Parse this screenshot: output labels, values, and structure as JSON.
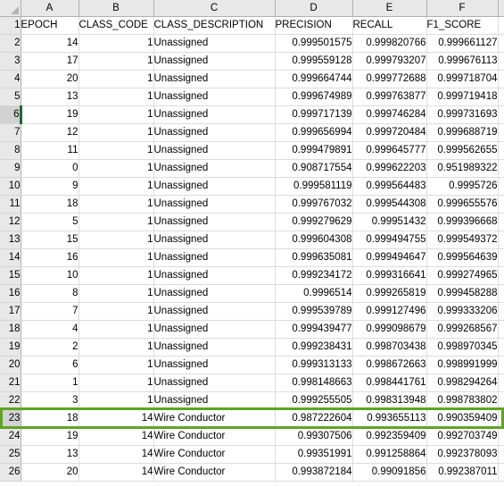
{
  "app": {
    "type": "spreadsheet",
    "select_all_corner_icon": "select-all-triangle-icon"
  },
  "colors": {
    "selection_green": "#5fa425",
    "active_marker_green": "#1d6b33",
    "header_gray": "#e8e8e8",
    "gridline": "#dcdcdc",
    "header_border": "#b0b0b0"
  },
  "column_headers": [
    "A",
    "B",
    "C",
    "D",
    "E",
    "F"
  ],
  "header_row_number": "1",
  "table": {
    "columns": [
      "EPOCH",
      "CLASS_CODE",
      "CLASS_DESCRIPTION",
      "PRECISION",
      "RECALL",
      "F1_SCORE"
    ],
    "rows": [
      {
        "n": "2",
        "EPOCH": "14",
        "CLASS_CODE": "1",
        "CLASS_DESCRIPTION": "Unassigned",
        "PRECISION": "0.999501575",
        "RECALL": "0.999820766",
        "F1_SCORE": "0.999661127"
      },
      {
        "n": "3",
        "EPOCH": "17",
        "CLASS_CODE": "1",
        "CLASS_DESCRIPTION": "Unassigned",
        "PRECISION": "0.999559128",
        "RECALL": "0.999793207",
        "F1_SCORE": "0.999676113"
      },
      {
        "n": "4",
        "EPOCH": "20",
        "CLASS_CODE": "1",
        "CLASS_DESCRIPTION": "Unassigned",
        "PRECISION": "0.999664744",
        "RECALL": "0.999772688",
        "F1_SCORE": "0.999718704"
      },
      {
        "n": "5",
        "EPOCH": "13",
        "CLASS_CODE": "1",
        "CLASS_DESCRIPTION": "Unassigned",
        "PRECISION": "0.999674989",
        "RECALL": "0.999763877",
        "F1_SCORE": "0.999719418"
      },
      {
        "n": "6",
        "EPOCH": "19",
        "CLASS_CODE": "1",
        "CLASS_DESCRIPTION": "Unassigned",
        "PRECISION": "0.999717139",
        "RECALL": "0.999746284",
        "F1_SCORE": "0.999731693"
      },
      {
        "n": "7",
        "EPOCH": "12",
        "CLASS_CODE": "1",
        "CLASS_DESCRIPTION": "Unassigned",
        "PRECISION": "0.999656994",
        "RECALL": "0.999720484",
        "F1_SCORE": "0.999688719"
      },
      {
        "n": "8",
        "EPOCH": "11",
        "CLASS_CODE": "1",
        "CLASS_DESCRIPTION": "Unassigned",
        "PRECISION": "0.999479891",
        "RECALL": "0.999645777",
        "F1_SCORE": "0.999562655"
      },
      {
        "n": "9",
        "EPOCH": "0",
        "CLASS_CODE": "1",
        "CLASS_DESCRIPTION": "Unassigned",
        "PRECISION": "0.908717554",
        "RECALL": "0.999622203",
        "F1_SCORE": "0.951989322"
      },
      {
        "n": "10",
        "EPOCH": "9",
        "CLASS_CODE": "1",
        "CLASS_DESCRIPTION": "Unassigned",
        "PRECISION": "0.999581119",
        "RECALL": "0.999564483",
        "F1_SCORE": "0.9995726"
      },
      {
        "n": "11",
        "EPOCH": "18",
        "CLASS_CODE": "1",
        "CLASS_DESCRIPTION": "Unassigned",
        "PRECISION": "0.999767032",
        "RECALL": "0.999544308",
        "F1_SCORE": "0.999655576"
      },
      {
        "n": "12",
        "EPOCH": "5",
        "CLASS_CODE": "1",
        "CLASS_DESCRIPTION": "Unassigned",
        "PRECISION": "0.999279629",
        "RECALL": "0.99951432",
        "F1_SCORE": "0.999396668"
      },
      {
        "n": "13",
        "EPOCH": "15",
        "CLASS_CODE": "1",
        "CLASS_DESCRIPTION": "Unassigned",
        "PRECISION": "0.999604308",
        "RECALL": "0.999494755",
        "F1_SCORE": "0.999549372"
      },
      {
        "n": "14",
        "EPOCH": "16",
        "CLASS_CODE": "1",
        "CLASS_DESCRIPTION": "Unassigned",
        "PRECISION": "0.999635081",
        "RECALL": "0.999494647",
        "F1_SCORE": "0.999564639"
      },
      {
        "n": "15",
        "EPOCH": "10",
        "CLASS_CODE": "1",
        "CLASS_DESCRIPTION": "Unassigned",
        "PRECISION": "0.999234172",
        "RECALL": "0.999316641",
        "F1_SCORE": "0.999274965"
      },
      {
        "n": "16",
        "EPOCH": "8",
        "CLASS_CODE": "1",
        "CLASS_DESCRIPTION": "Unassigned",
        "PRECISION": "0.9996514",
        "RECALL": "0.999265819",
        "F1_SCORE": "0.999458288"
      },
      {
        "n": "17",
        "EPOCH": "7",
        "CLASS_CODE": "1",
        "CLASS_DESCRIPTION": "Unassigned",
        "PRECISION": "0.999539789",
        "RECALL": "0.999127496",
        "F1_SCORE": "0.999333206"
      },
      {
        "n": "18",
        "EPOCH": "4",
        "CLASS_CODE": "1",
        "CLASS_DESCRIPTION": "Unassigned",
        "PRECISION": "0.999439477",
        "RECALL": "0.999098679",
        "F1_SCORE": "0.999268567"
      },
      {
        "n": "19",
        "EPOCH": "2",
        "CLASS_CODE": "1",
        "CLASS_DESCRIPTION": "Unassigned",
        "PRECISION": "0.999238431",
        "RECALL": "0.998703438",
        "F1_SCORE": "0.998970345"
      },
      {
        "n": "20",
        "EPOCH": "6",
        "CLASS_CODE": "1",
        "CLASS_DESCRIPTION": "Unassigned",
        "PRECISION": "0.999313133",
        "RECALL": "0.998672663",
        "F1_SCORE": "0.998991999"
      },
      {
        "n": "21",
        "EPOCH": "1",
        "CLASS_CODE": "1",
        "CLASS_DESCRIPTION": "Unassigned",
        "PRECISION": "0.998148663",
        "RECALL": "0.998441761",
        "F1_SCORE": "0.998294264"
      },
      {
        "n": "22",
        "EPOCH": "3",
        "CLASS_CODE": "1",
        "CLASS_DESCRIPTION": "Unassigned",
        "PRECISION": "0.999255505",
        "RECALL": "0.998313948",
        "F1_SCORE": "0.998783802"
      },
      {
        "n": "23",
        "EPOCH": "18",
        "CLASS_CODE": "14",
        "CLASS_DESCRIPTION": "Wire Conductor",
        "PRECISION": "0.987222604",
        "RECALL": "0.993655113",
        "F1_SCORE": "0.990359409"
      },
      {
        "n": "24",
        "EPOCH": "19",
        "CLASS_CODE": "14",
        "CLASS_DESCRIPTION": "Wire Conductor",
        "PRECISION": "0.99307506",
        "RECALL": "0.992359409",
        "F1_SCORE": "0.992703749"
      },
      {
        "n": "25",
        "EPOCH": "13",
        "CLASS_CODE": "14",
        "CLASS_DESCRIPTION": "Wire Conductor",
        "PRECISION": "0.99351991",
        "RECALL": "0.991258864",
        "F1_SCORE": "0.992378093"
      },
      {
        "n": "26",
        "EPOCH": "20",
        "CLASS_CODE": "14",
        "CLASS_DESCRIPTION": "Wire Conductor",
        "PRECISION": "0.993872184",
        "RECALL": "0.99091856",
        "F1_SCORE": "0.992387011"
      }
    ]
  },
  "state": {
    "active_cell_row_number": "6",
    "selected_row_number": "23"
  }
}
